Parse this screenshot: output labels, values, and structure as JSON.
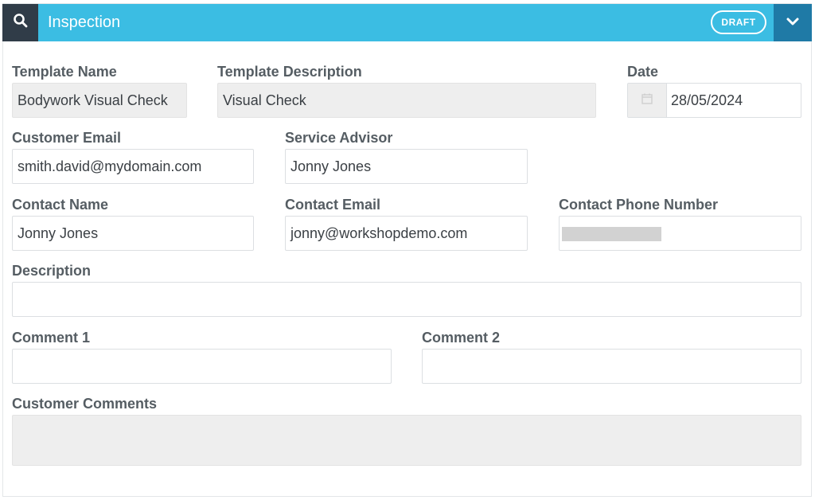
{
  "header": {
    "title": "Inspection",
    "status_badge": "DRAFT"
  },
  "form": {
    "template_name": {
      "label": "Template Name",
      "value": "Bodywork Visual Check"
    },
    "template_description": {
      "label": "Template Description",
      "value": "Visual Check"
    },
    "date": {
      "label": "Date",
      "value": "28/05/2024"
    },
    "customer_email": {
      "label": "Customer Email",
      "value": "smith.david@mydomain.com"
    },
    "service_advisor": {
      "label": "Service Advisor",
      "value": "Jonny Jones"
    },
    "contact_name": {
      "label": "Contact Name",
      "value": "Jonny Jones"
    },
    "contact_email": {
      "label": "Contact Email",
      "value": "jonny@workshopdemo.com"
    },
    "contact_phone": {
      "label": "Contact Phone Number",
      "value": ""
    },
    "description": {
      "label": "Description",
      "value": ""
    },
    "comment1": {
      "label": "Comment 1",
      "value": ""
    },
    "comment2": {
      "label": "Comment 2",
      "value": ""
    },
    "customer_comments": {
      "label": "Customer Comments",
      "value": ""
    }
  },
  "icons": {
    "search": "search-icon",
    "chevron": "chevron-down-icon",
    "calendar": "calendar-icon"
  },
  "colors": {
    "header_bg": "#3bbde3",
    "search_bg": "#303c48",
    "chevron_bg": "#1f7aa6",
    "label_text": "#555d63"
  }
}
